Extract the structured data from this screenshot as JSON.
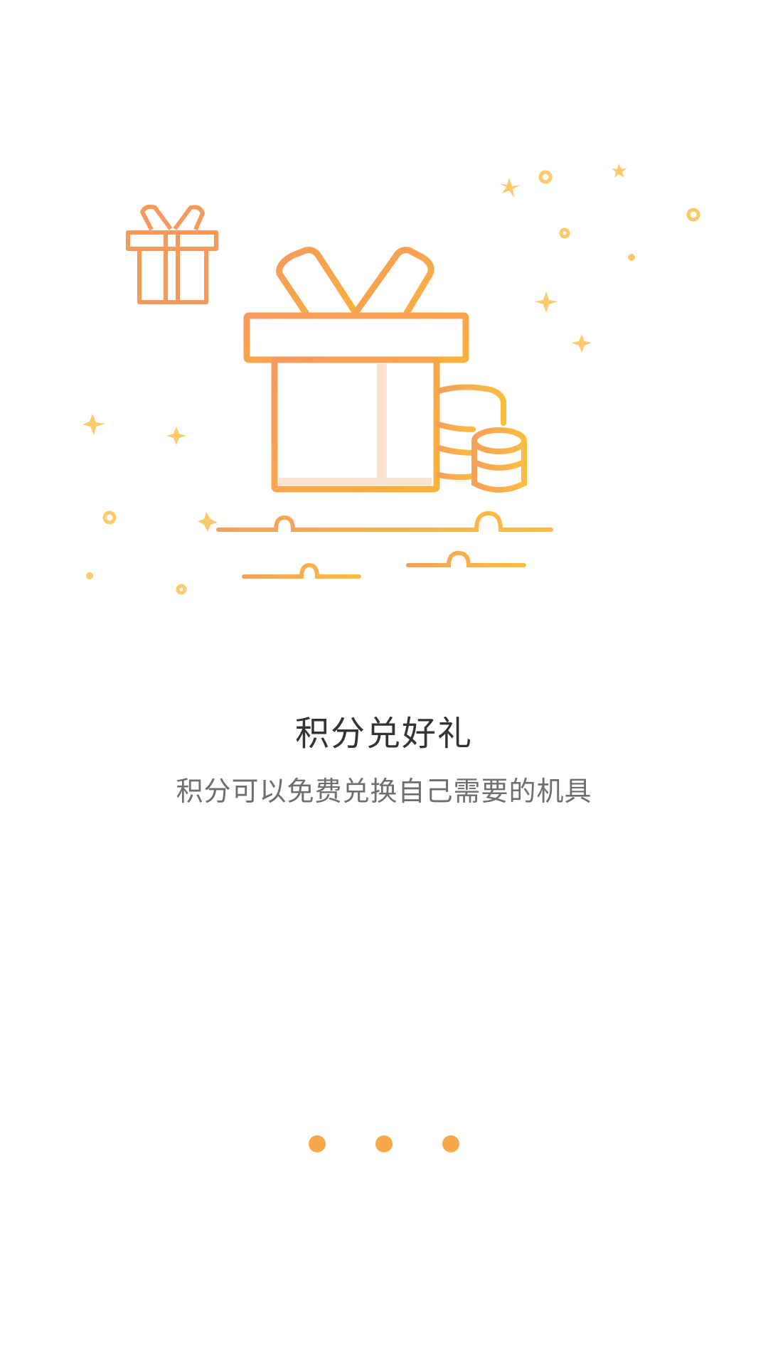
{
  "onboarding": {
    "title": "积分兑好礼",
    "subtitle": "积分可以免费兑换自己需要的机具"
  },
  "illustration": {
    "icon": "gift-box-with-coins-icon"
  },
  "pager": {
    "page_count": 3,
    "dot_color": "#f7a84b"
  },
  "colors": {
    "accent_start": "#f69c5a",
    "accent_end": "#fbb13c",
    "sparkle": "#fcc96b",
    "title_text": "#333333",
    "subtitle_text": "#6e6e6e"
  }
}
